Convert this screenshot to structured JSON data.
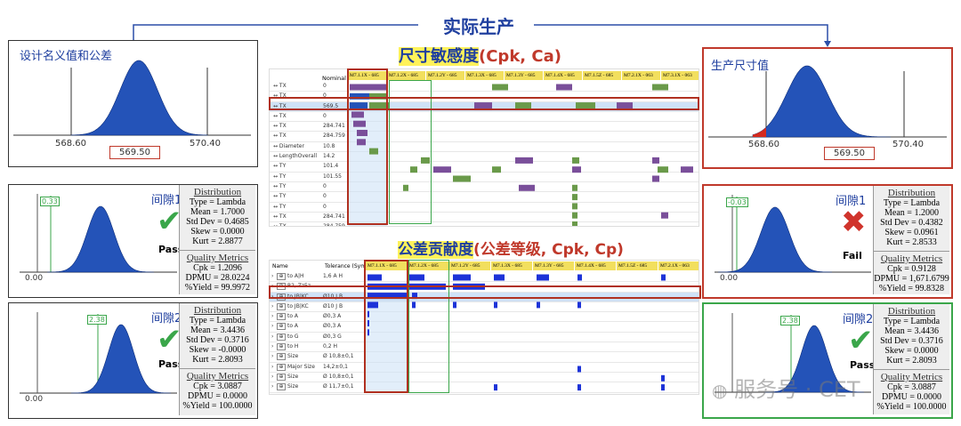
{
  "top_label": "实际生产",
  "left_top": {
    "title": "设计名义值和公差",
    "axis": [
      "568.60",
      "570.40"
    ],
    "nominal": "569.50"
  },
  "right_top": {
    "title": "生产尺寸值",
    "axis": [
      "568.60",
      "570.40"
    ],
    "nominal": "569.50"
  },
  "sensitivity_title": {
    "cn": "尺寸敏感度",
    "en": "(Cpk, Ca)"
  },
  "contribution_title": {
    "cn": "公差贡献度",
    "mid": "(公差等级",
    "en": ", Cpk, Cp)"
  },
  "sens_table": {
    "col_nominal": "Nominal",
    "headers": [
      "M7.1.1X - 685",
      "M7.1.2X - 685",
      "M7.1.2Y - 685",
      "M7.1.3X - 685",
      "M7.1.3Y - 685",
      "M7.1.4X - 685",
      "M7.1.5Z - 685",
      "M7.2.1X - 063",
      "M7.3.1X - 063"
    ],
    "rows": [
      {
        "name": "↔ TX",
        "val": "0"
      },
      {
        "name": "↔ TX",
        "val": "0"
      },
      {
        "name": "↔ TX",
        "val": "569.5"
      },
      {
        "name": "↔ TX",
        "val": "0"
      },
      {
        "name": "↔ TX",
        "val": "284.741"
      },
      {
        "name": "↔ TX",
        "val": "284.759"
      },
      {
        "name": "↔ Diameter",
        "val": "10.8"
      },
      {
        "name": "↔ LengthOverall",
        "val": "14.2"
      },
      {
        "name": "↔ TY",
        "val": "101.4"
      },
      {
        "name": "↔ TY",
        "val": "101.55"
      },
      {
        "name": "↔ TY",
        "val": "0"
      },
      {
        "name": "↔ TY",
        "val": "0"
      },
      {
        "name": "↔ TY",
        "val": "0"
      },
      {
        "name": "↔ TX",
        "val": "284.741"
      },
      {
        "name": "↔ TX",
        "val": "284.759"
      },
      {
        "name": "↔ TY",
        "val": "203"
      }
    ]
  },
  "contrib_table": {
    "col_name": "Name",
    "col_tol": "Tolerance (Symbol)",
    "headers": [
      "M7.1.1X - 685",
      "M7.1.2X - 685",
      "M7.1.2Y - 685",
      "M7.1.3X - 685",
      "M7.1.3Y - 685",
      "M7.1.4X - 685",
      "M7.1.5Z - 685",
      "M7.2.1X - 063"
    ],
    "rows": [
      {
        "name": "to A|H",
        "tol": "1,6 A H"
      },
      {
        "name": "R2, Zz5z",
        "tol": ""
      },
      {
        "name": "to JB|KC",
        "tol": "Ø10 J B"
      },
      {
        "name": "to JB|KC",
        "tol": "Ø10 J B"
      },
      {
        "name": "to A",
        "tol": "Ø0,3 A"
      },
      {
        "name": "to A",
        "tol": "Ø0,3 A"
      },
      {
        "name": "to G",
        "tol": "Ø0,3 G"
      },
      {
        "name": "to H",
        "tol": "0,2 H"
      },
      {
        "name": "Size",
        "tol": "Ø 10,8±0,1"
      },
      {
        "name": "Major Size",
        "tol": "14,2±0,1"
      },
      {
        "name": "Size",
        "tol": "Ø 10,8±0,1"
      },
      {
        "name": "Size",
        "tol": "Ø 11,7±0,1"
      },
      {
        "name": "B2, Rz",
        "tol": ""
      }
    ]
  },
  "gap1_pass": {
    "title": "间隙1",
    "marker": "0.33",
    "zero": "0.00",
    "verdict": "Pass",
    "dist_head": "Distribution",
    "dist": [
      "Type = Lambda",
      "Mean = 1.7000",
      "Std Dev = 0.4685",
      "Skew = 0.0000",
      "Kurt = 2.8877"
    ],
    "qm_head": "Quality Metrics",
    "qm": [
      "Cpk = 1.2096",
      "DPMU = 28.0224",
      "%Yield = 99.9972"
    ]
  },
  "gap2_pass": {
    "title": "间隙2",
    "marker": "2.38",
    "zero": "0.00",
    "verdict": "Pass",
    "dist_head": "Distribution",
    "dist": [
      "Type = Lambda",
      "Mean = 3.4436",
      "Std Dev = 0.3716",
      "Skew = -0.0000",
      "Kurt = 2.8093"
    ],
    "qm_head": "Quality Metrics",
    "qm": [
      "Cpk = 3.0887",
      "DPMU = 0.0000",
      "%Yield = 100.0000"
    ]
  },
  "gap1_fail": {
    "title": "间隙1",
    "marker": "-0.03",
    "zero": "0.00",
    "verdict": "Fail",
    "dist_head": "Distribution",
    "dist": [
      "Type = Lambda",
      "Mean = 1.2000",
      "Std Dev = 0.4382",
      "Skew = 0.0961",
      "Kurt = 2.8533"
    ],
    "qm_head": "Quality Metrics",
    "qm": [
      "Cpk = 0.9128",
      "DPMU = 1,671.6799",
      "%Yield = 99.8328"
    ]
  },
  "gap2_right": {
    "title": "间隙2",
    "marker": "2.38",
    "verdict": "Pass",
    "dist_head": "Distribution",
    "dist": [
      "Type = Lambda",
      "Mean = 3.4436",
      "Std Dev = 0.3716",
      "Skew = 0.0000",
      "Kurt = 2.8093"
    ],
    "qm_head": "Quality Metrics",
    "qm": [
      "Cpk = 3.0887",
      "DPMU = 0.0000",
      "%Yield = 100.0000"
    ]
  },
  "watermark": "服务号 · CET",
  "colors": {
    "accent_blue": "#1f3f9f",
    "fill_blue": "#2453b8",
    "red": "#c0392b",
    "green": "#3aa64a",
    "header_yellow": "#f2df5e",
    "purple": "#7a4f9a",
    "bar_green": "#6a9a4a"
  }
}
